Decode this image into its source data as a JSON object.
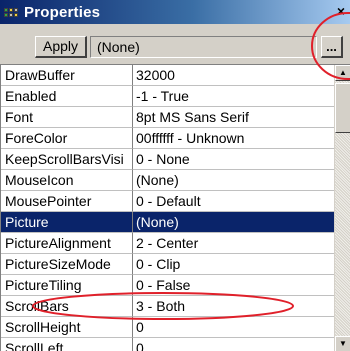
{
  "window": {
    "title": "Properties",
    "close_glyph": "×"
  },
  "toolbar": {
    "apply_label": "Apply",
    "value": "(None)",
    "ellipsis_label": "..."
  },
  "properties": [
    {
      "name": "DrawBuffer",
      "value": "32000"
    },
    {
      "name": "Enabled",
      "value": "-1 - True"
    },
    {
      "name": "Font",
      "value": "8pt MS Sans Serif"
    },
    {
      "name": "ForeColor",
      "value": "00ffffff - Unknown"
    },
    {
      "name": "KeepScrollBarsVisi",
      "value": "0 - None"
    },
    {
      "name": "MouseIcon",
      "value": "(None)"
    },
    {
      "name": "MousePointer",
      "value": "0 - Default"
    },
    {
      "name": "Picture",
      "value": "(None)"
    },
    {
      "name": "PictureAlignment",
      "value": "2 - Center"
    },
    {
      "name": "PictureSizeMode",
      "value": "0 - Clip"
    },
    {
      "name": "PictureTiling",
      "value": "0 - False"
    },
    {
      "name": "ScrollBars",
      "value": "3 - Both"
    },
    {
      "name": "ScrollHeight",
      "value": "0"
    },
    {
      "name": "ScrollLeft",
      "value": "0"
    }
  ],
  "selected_property": "Picture",
  "icons": {
    "title": "properties-grid-icon",
    "close": "close-icon",
    "scroll_up": "arrow-up-icon",
    "scroll_down": "arrow-down-icon"
  },
  "colors": {
    "title_bar_start": "#0a246a",
    "title_bar_end": "#a6caf0",
    "selection": "#0a246a",
    "annotation": "#e0202a"
  }
}
